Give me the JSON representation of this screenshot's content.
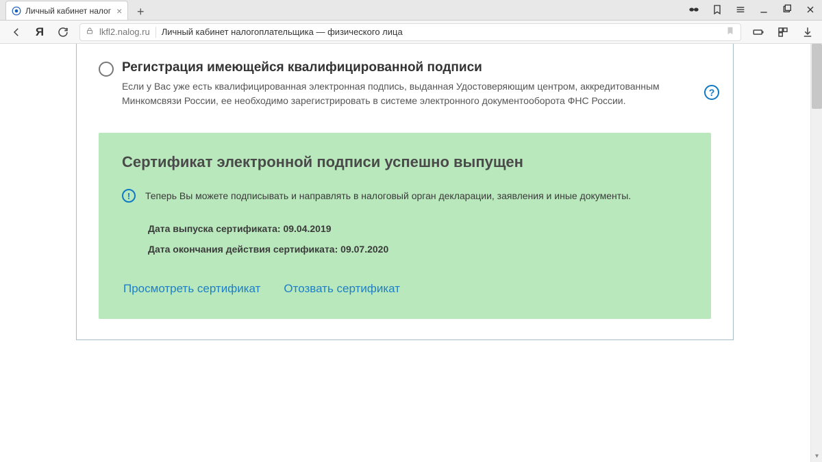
{
  "browser": {
    "tab_title": "Личный кабинет налог",
    "url_host": "lkfl2.nalog.ru",
    "url_title": "Личный кабинет налогоплательщика — физического лица"
  },
  "option": {
    "title": "Регистрация имеющейся квалифицированной подписи",
    "description": "Если у Вас уже есть квалифицированная электронная подпись, выданная Удостоверяющим центром, аккредитованным Минкомсвязи России, ее необходимо зарегистрировать в системе электронного документооборота ФНС России."
  },
  "help_symbol": "?",
  "success": {
    "title": "Сертификат электронной подписи успешно выпущен",
    "info_icon": "!",
    "info_text": "Теперь Вы можете подписывать и направлять в налоговый орган декларации, заявления и иные документы.",
    "issue_label": "Дата выпуска сертификата:",
    "issue_date": "09.04.2019",
    "expiry_label": "Дата окончания действия сертификата:",
    "expiry_date": "09.07.2020",
    "view_link": "Просмотреть сертификат",
    "revoke_link": "Отозвать сертификат"
  }
}
